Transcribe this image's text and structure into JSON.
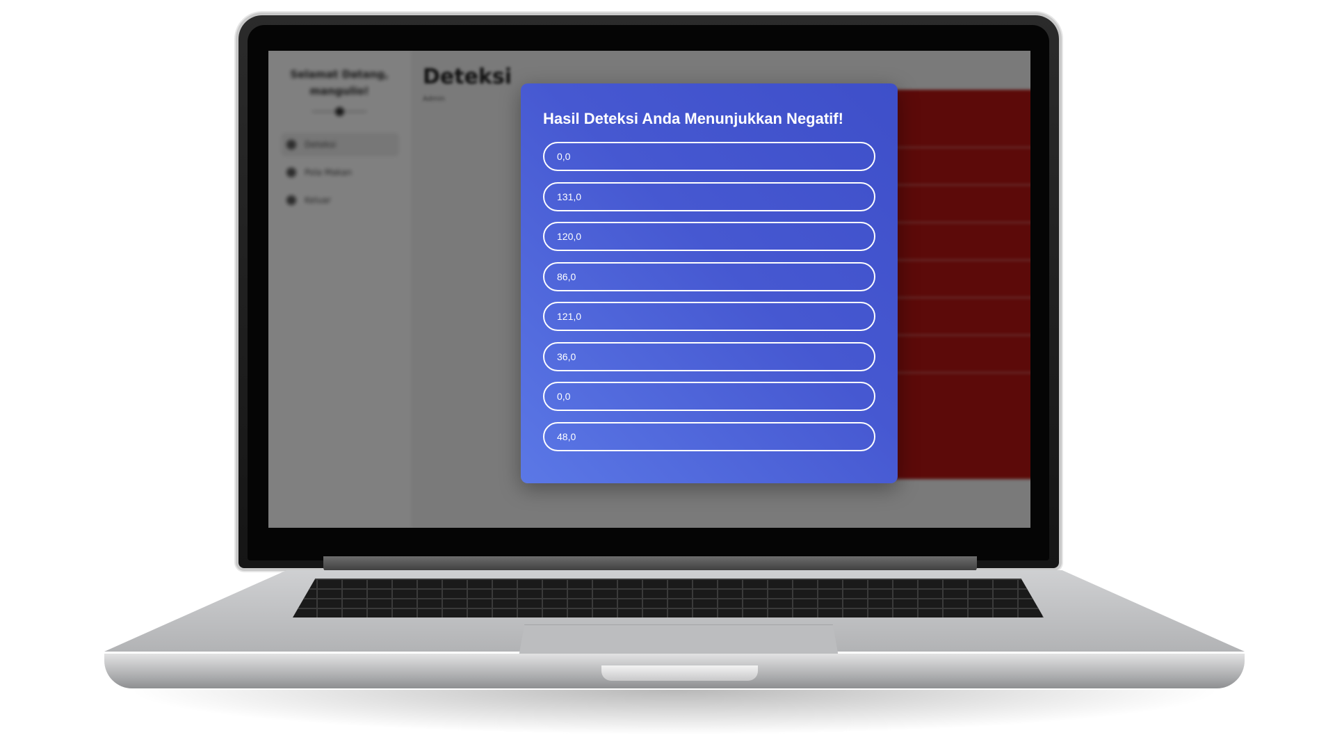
{
  "background_app": {
    "brand_title": "Selamat Datang, mangulio!",
    "page_title": "Deteksi",
    "page_subtitle": "Admin",
    "sidebar": {
      "items": [
        {
          "label": "Deteksi",
          "icon": "detect-icon",
          "active": true
        },
        {
          "label": "Pola Makan",
          "icon": "food-icon",
          "active": false
        },
        {
          "label": "Keluar",
          "icon": "logout-icon",
          "active": false
        }
      ]
    }
  },
  "modal": {
    "title": "Hasil Deteksi Anda Menunjukkan Negatif!",
    "results": [
      "0,0",
      "131,0",
      "120,0",
      "86,0",
      "121,0",
      "36,0",
      "0,0",
      "48,0"
    ]
  },
  "colors": {
    "modal_gradient_start": "#5b78e6",
    "modal_gradient_end": "#3e4fc9",
    "background_panel": "#b01412",
    "overlay": "rgba(0,0,0,0.48)"
  }
}
